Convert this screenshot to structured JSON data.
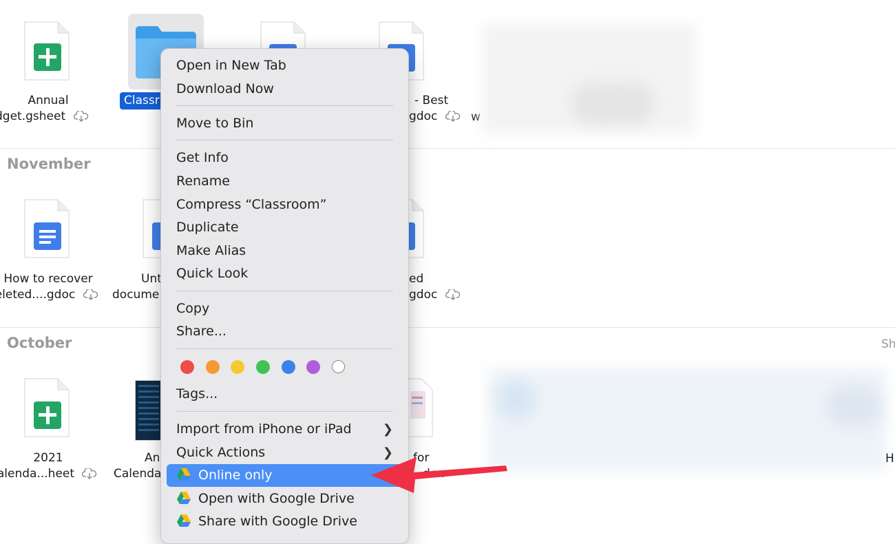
{
  "sections": {
    "november": "November",
    "october": "October",
    "right_edge_top": "Sh",
    "right_edge_bottom": "H"
  },
  "files": {
    "annual_budget": [
      "Annual",
      "budget.gsheet"
    ],
    "classroom": "Classr",
    "best_doc": [
      "- Best",
      "gdoc"
    ],
    "w_partial": "w",
    "how_to_recover": [
      "How to recover",
      "leleted....gdoc"
    ],
    "untitled": [
      "Unt",
      "docume..."
    ],
    "ed_doc": [
      "ed",
      "gdoc"
    ],
    "calendar_2021": [
      "2021",
      "Calenda...heet"
    ],
    "an_calendar": [
      "An",
      "Calenda"
    ],
    "for_doc": [
      "for",
      "dex"
    ]
  },
  "menu": {
    "items": [
      {
        "label": "Open in New Tab"
      },
      {
        "label": "Download Now"
      },
      {
        "label": "Move to Bin"
      },
      {
        "label": "Get Info"
      },
      {
        "label": "Rename"
      },
      {
        "label": "Compress “Classroom”"
      },
      {
        "label": "Duplicate"
      },
      {
        "label": "Make Alias"
      },
      {
        "label": "Quick Look"
      },
      {
        "label": "Copy"
      },
      {
        "label": "Share..."
      },
      {
        "label": "Tags..."
      },
      {
        "label": "Import from iPhone or iPad"
      },
      {
        "label": "Quick Actions"
      },
      {
        "label": "Online only"
      },
      {
        "label": "Open with Google Drive"
      },
      {
        "label": "Share with Google Drive"
      }
    ],
    "tag_colors": [
      "#ee4c45",
      "#f59a33",
      "#f5c932",
      "#41c354",
      "#3b82ec",
      "#b15fd9",
      "#ffffff"
    ],
    "highlight_color": "#4b8ff7",
    "arrow_color": "#ee2f44"
  }
}
